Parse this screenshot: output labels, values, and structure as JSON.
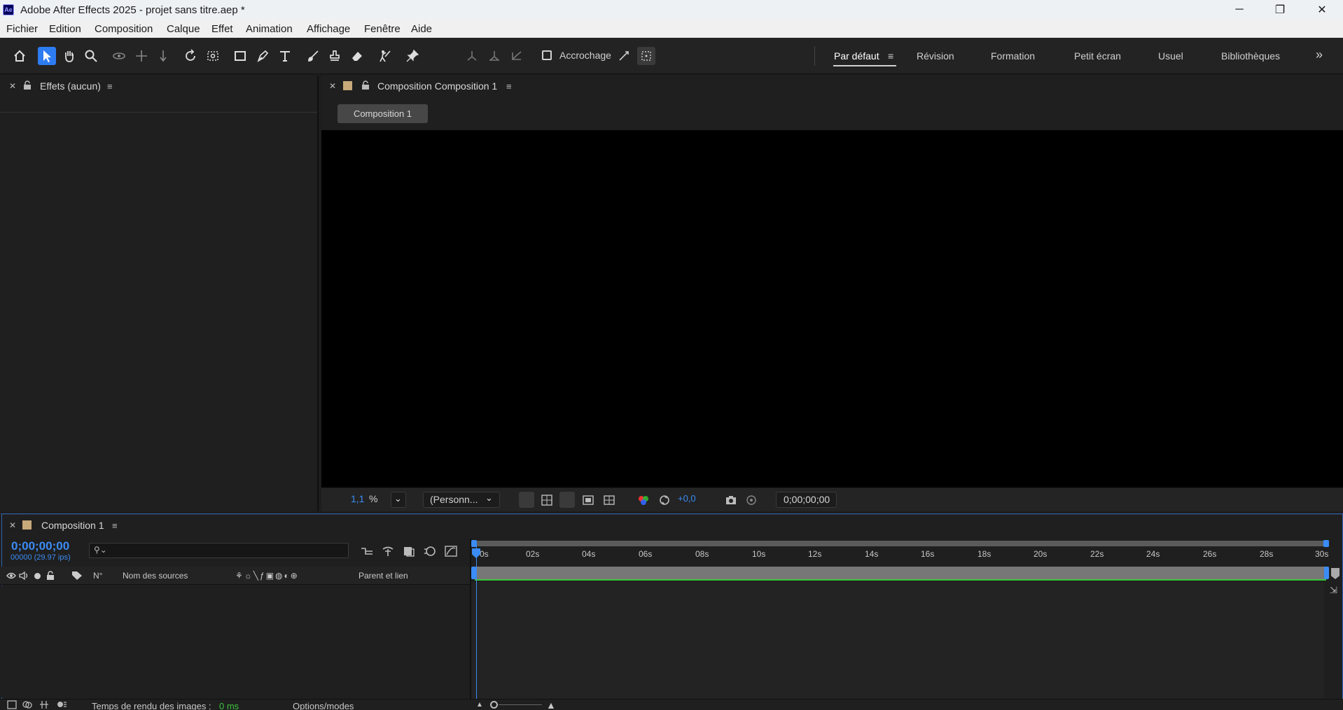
{
  "window": {
    "logo": "Ae",
    "title": "Adobe After Effects 2025 - projet sans titre.aep *",
    "minimize": "─",
    "restore": "❐",
    "close": "✕"
  },
  "menu": [
    "Fichier",
    "Edition",
    "Composition",
    "Calque",
    "Effet",
    "Animation",
    "Affichage",
    "Fenêtre",
    "Aide"
  ],
  "toolbar": {
    "snap_label": "Accrochage",
    "workspaces": [
      "Par défaut",
      "Révision",
      "Formation",
      "Petit écran",
      "Usuel",
      "Bibliothèques"
    ],
    "workspace_more": "»"
  },
  "effects_panel": {
    "title": "Effets (aucun)"
  },
  "comp_panel": {
    "title": "Composition Composition 1",
    "tab_pill": "Composition 1",
    "zoom_value": "1,1",
    "zoom_unit": "%",
    "resolution": "(Personn...",
    "exposure": "+0,0",
    "timecode": "0;00;00;00"
  },
  "timeline": {
    "tab_title": "Composition 1",
    "timecode": "0;00;00;00",
    "frames_info": "00000 (29.97 ips)",
    "search_placeholder": "",
    "col_number": "N°",
    "col_source": "Nom des sources",
    "col_parent": "Parent et lien",
    "ruler": [
      "0s",
      "02s",
      "04s",
      "06s",
      "08s",
      "10s",
      "12s",
      "14s",
      "16s",
      "18s",
      "20s",
      "22s",
      "24s",
      "26s",
      "28s",
      "30s"
    ]
  },
  "status_bar": {
    "render_label": "Temps de rendu des images :",
    "render_value": "0 ms",
    "options": "Options/modes"
  },
  "colors": {
    "accent_blue": "#3b8cf5",
    "work_area_green": "#3bc43b",
    "label_tan": "#c8a97a"
  }
}
